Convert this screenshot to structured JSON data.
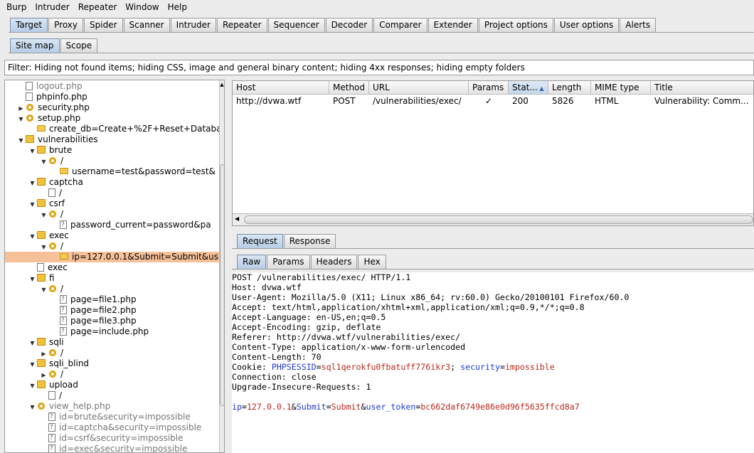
{
  "menu": [
    "Burp",
    "Intruder",
    "Repeater",
    "Window",
    "Help"
  ],
  "main_tabs": [
    "Target",
    "Proxy",
    "Spider",
    "Scanner",
    "Intruder",
    "Repeater",
    "Sequencer",
    "Decoder",
    "Comparer",
    "Extender",
    "Project options",
    "User options",
    "Alerts"
  ],
  "active_main_tab": "Target",
  "sub_tabs": [
    "Site map",
    "Scope"
  ],
  "active_sub_tab": "Site map",
  "filter": "Filter: Hiding not found items;  hiding CSS, image and general binary content;  hiding 4xx responses;  hiding empty folders",
  "tree": [
    {
      "label": "logout.php",
      "depth": 1,
      "icon": "file",
      "arrow": "",
      "grey": true
    },
    {
      "label": "phpinfo.php",
      "depth": 1,
      "icon": "file",
      "arrow": "",
      "grey": false
    },
    {
      "label": "security.php",
      "depth": 1,
      "icon": "gear",
      "arrow": "right",
      "grey": false
    },
    {
      "label": "setup.php",
      "depth": 1,
      "icon": "gear",
      "arrow": "down",
      "grey": false
    },
    {
      "label": "create_db=Create+%2F+Reset+Databa",
      "depth": 2,
      "icon": "envelope",
      "arrow": "",
      "grey": false
    },
    {
      "label": "vulnerabilities",
      "depth": 1,
      "icon": "folder",
      "arrow": "down",
      "grey": false
    },
    {
      "label": "brute",
      "depth": 2,
      "icon": "folder",
      "arrow": "down",
      "grey": false
    },
    {
      "label": "/",
      "depth": 3,
      "icon": "gear",
      "arrow": "down",
      "grey": false
    },
    {
      "label": "username=test&password=test&",
      "depth": 4,
      "icon": "envelope",
      "arrow": "",
      "grey": false
    },
    {
      "label": "captcha",
      "depth": 2,
      "icon": "folder",
      "arrow": "down",
      "grey": false
    },
    {
      "label": "/",
      "depth": 3,
      "icon": "file",
      "arrow": "",
      "grey": false
    },
    {
      "label": "csrf",
      "depth": 2,
      "icon": "folder",
      "arrow": "down",
      "grey": false
    },
    {
      "label": "/",
      "depth": 3,
      "icon": "gear",
      "arrow": "down",
      "grey": false
    },
    {
      "label": "password_current=password&pa",
      "depth": 4,
      "icon": "file-q",
      "arrow": "",
      "grey": false
    },
    {
      "label": "exec",
      "depth": 2,
      "icon": "folder",
      "arrow": "down",
      "grey": false
    },
    {
      "label": "/",
      "depth": 3,
      "icon": "gear",
      "arrow": "down",
      "grey": false
    },
    {
      "label": "ip=127.0.0.1&Submit=Submit&us",
      "depth": 4,
      "icon": "envelope",
      "arrow": "",
      "grey": false,
      "selected": true
    },
    {
      "label": "exec",
      "depth": 2,
      "icon": "file",
      "arrow": "",
      "grey": false
    },
    {
      "label": "fi",
      "depth": 2,
      "icon": "folder",
      "arrow": "down",
      "grey": false
    },
    {
      "label": "/",
      "depth": 3,
      "icon": "gear",
      "arrow": "down",
      "grey": false
    },
    {
      "label": "page=file1.php",
      "depth": 4,
      "icon": "file-q",
      "arrow": "",
      "grey": false
    },
    {
      "label": "page=file2.php",
      "depth": 4,
      "icon": "file-q",
      "arrow": "",
      "grey": false
    },
    {
      "label": "page=file3.php",
      "depth": 4,
      "icon": "file-q",
      "arrow": "",
      "grey": false
    },
    {
      "label": "page=include.php",
      "depth": 4,
      "icon": "file-q",
      "arrow": "",
      "grey": false
    },
    {
      "label": "sqli",
      "depth": 2,
      "icon": "folder",
      "arrow": "down",
      "grey": false
    },
    {
      "label": "/",
      "depth": 3,
      "icon": "gear",
      "arrow": "right",
      "grey": false
    },
    {
      "label": "sqli_blind",
      "depth": 2,
      "icon": "folder",
      "arrow": "down",
      "grey": false
    },
    {
      "label": "/",
      "depth": 3,
      "icon": "gear",
      "arrow": "right",
      "grey": false
    },
    {
      "label": "upload",
      "depth": 2,
      "icon": "folder",
      "arrow": "down",
      "grey": false
    },
    {
      "label": "/",
      "depth": 3,
      "icon": "file",
      "arrow": "",
      "grey": false
    },
    {
      "label": "view_help.php",
      "depth": 2,
      "icon": "gear",
      "arrow": "down",
      "grey": true
    },
    {
      "label": "id=brute&security=impossible",
      "depth": 3,
      "icon": "file-q",
      "arrow": "",
      "grey": true
    },
    {
      "label": "id=captcha&security=impossible",
      "depth": 3,
      "icon": "file-q",
      "arrow": "",
      "grey": true
    },
    {
      "label": "id=csrf&security=impossible",
      "depth": 3,
      "icon": "file-q",
      "arrow": "",
      "grey": true
    },
    {
      "label": "id=exec&security=impossible",
      "depth": 3,
      "icon": "file-q",
      "arrow": "",
      "grey": true
    }
  ],
  "table": {
    "columns": [
      "Host",
      "Method",
      "URL",
      "Params",
      "Stat...",
      "Length",
      "MIME type",
      "Title"
    ],
    "sorted_column": "Stat...",
    "rows": [
      {
        "host": "http://dvwa.wtf",
        "method": "POST",
        "url": "/vulnerabilities/exec/",
        "params": "✓",
        "status": "200",
        "length": "5826",
        "mime": "HTML",
        "title": "Vulnerability: Comm..."
      }
    ]
  },
  "rr_tabs": [
    "Request",
    "Response"
  ],
  "active_rr_tab": "Request",
  "format_tabs": [
    "Raw",
    "Params",
    "Headers",
    "Hex"
  ],
  "active_format_tab": "Raw",
  "request": {
    "lines": [
      "POST /vulnerabilities/exec/ HTTP/1.1",
      "Host: dvwa.wtf",
      "User-Agent: Mozilla/5.0 (X11; Linux x86_64; rv:60.0) Gecko/20100101 Firefox/60.0",
      "Accept: text/html,application/xhtml+xml,application/xml;q=0.9,*/*;q=0.8",
      "Accept-Language: en-US,en;q=0.5",
      "Accept-Encoding: gzip, deflate",
      "Referer: http://dvwa.wtf/vulnerabilities/exec/",
      "Content-Type: application/x-www-form-urlencoded",
      "Content-Length: 70"
    ],
    "cookie_prefix": "Cookie: ",
    "cookie_name1": "PHPSESSID",
    "cookie_eq1": "=",
    "cookie_val1": "sql1qerokfu0fbatuff776ikr3",
    "cookie_sep": "; ",
    "cookie_name2": "security",
    "cookie_eq2": "=",
    "cookie_val2": "impossible",
    "lines_after": [
      "Connection: close",
      "Upgrade-Insecure-Requests: 1",
      ""
    ],
    "body": [
      {
        "name": "ip",
        "value": "127.0.0.1"
      },
      {
        "name": "Submit",
        "value": "Submit"
      },
      {
        "name": "user_token",
        "value": "bc662daf6749e86e0d96f5635ffcd8a7"
      }
    ]
  }
}
